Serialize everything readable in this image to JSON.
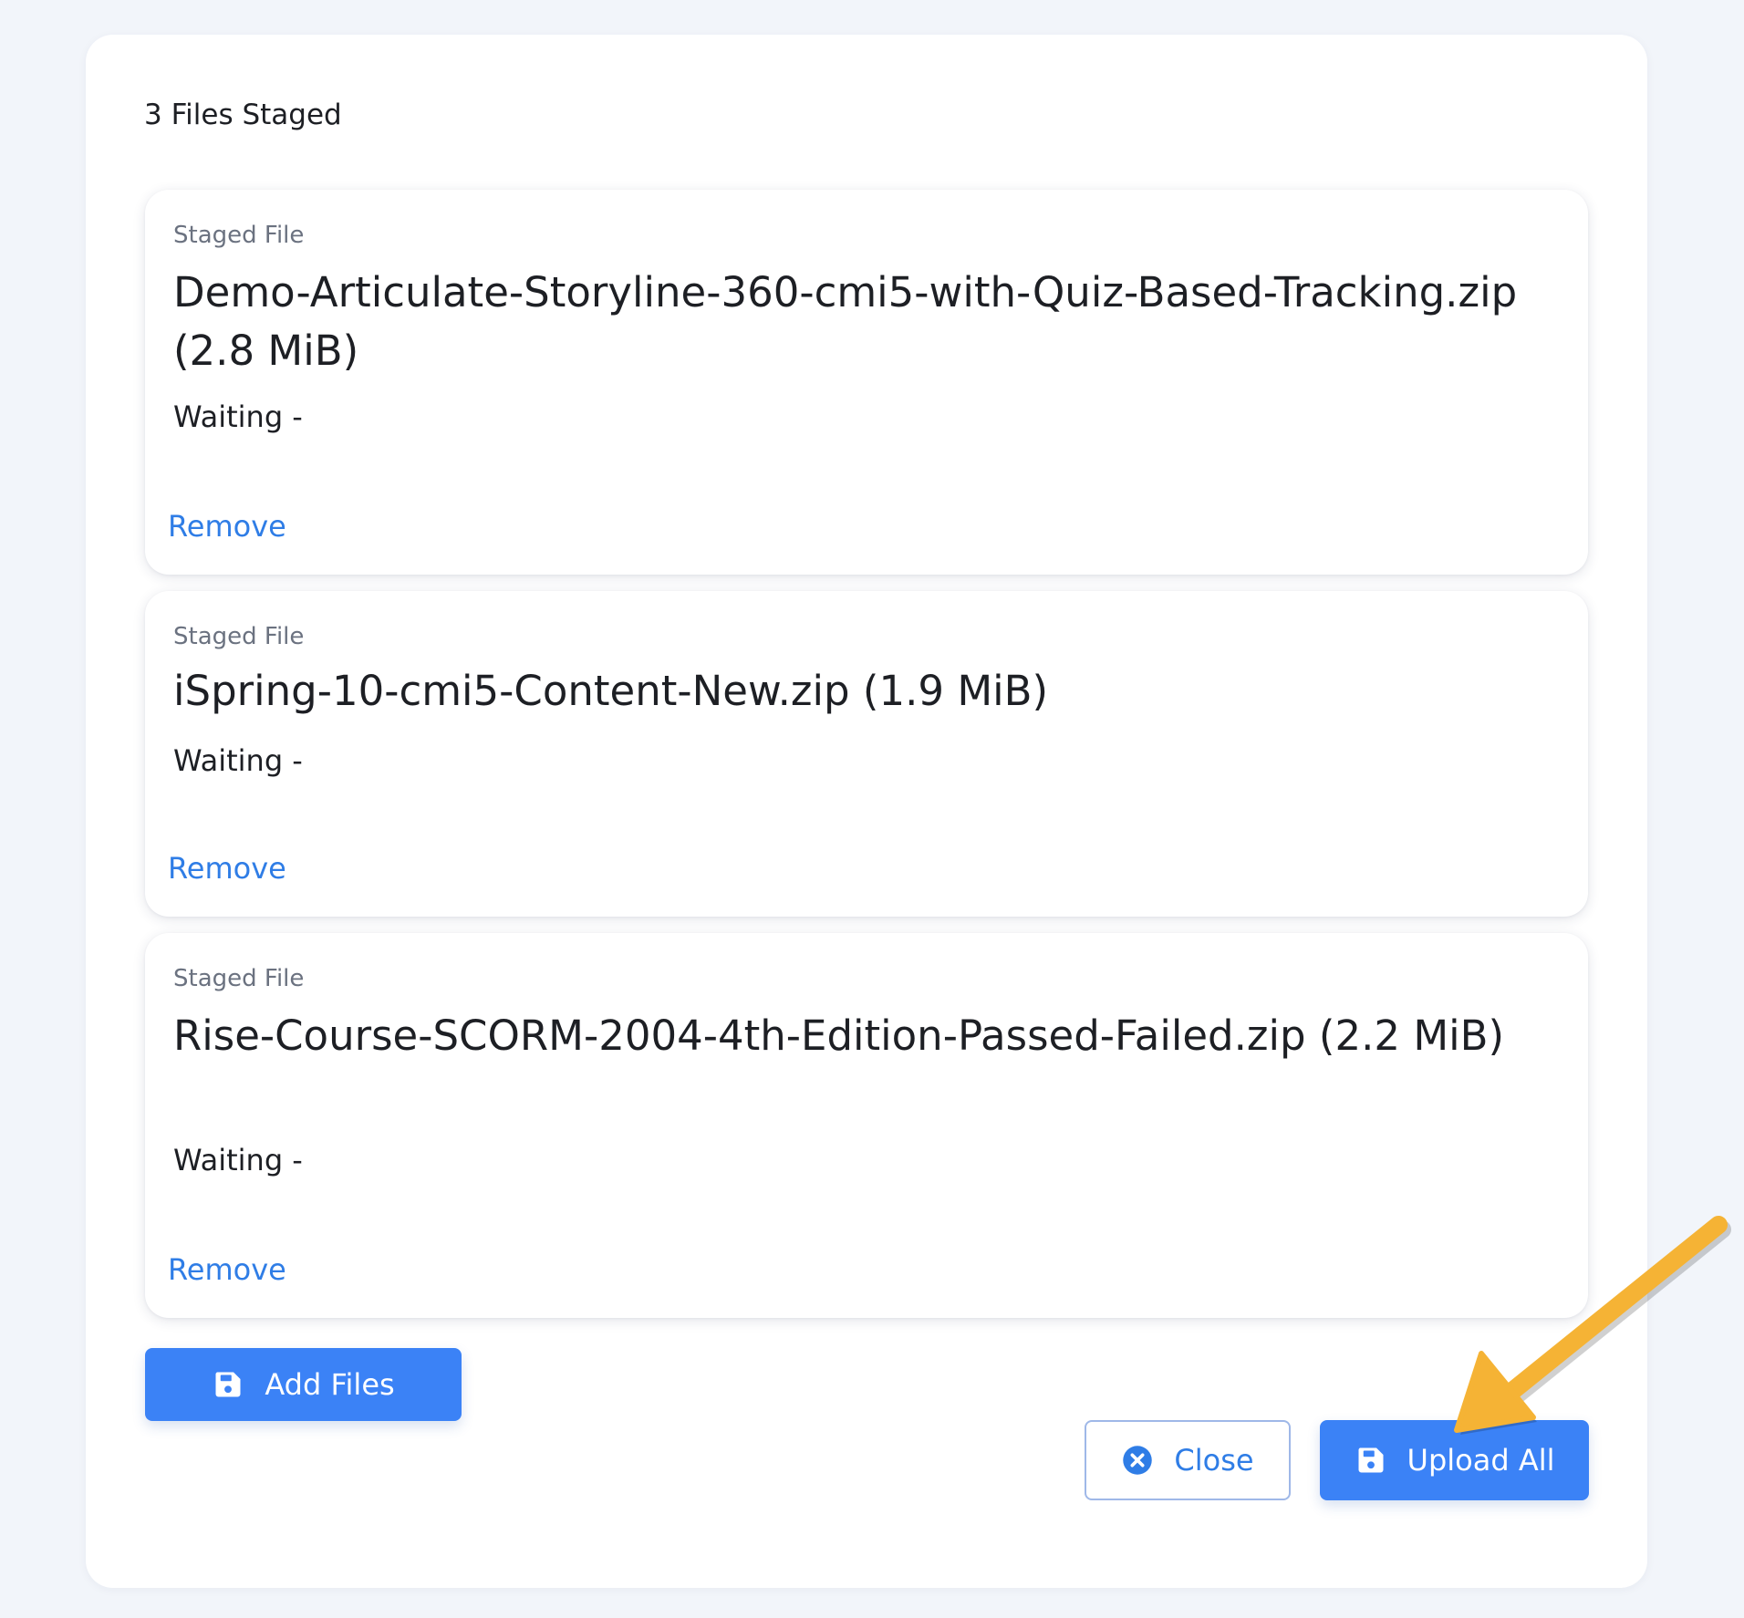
{
  "header": {
    "title": "3 Files Staged"
  },
  "staged_files": [
    {
      "kicker": "Staged File",
      "name": "Demo-Articulate-Storyline-360-cmi5-with-Quiz-Based-Tracking.zip (2.8 MiB)",
      "status": "Waiting -",
      "remove_label": "Remove"
    },
    {
      "kicker": "Staged File",
      "name": "iSpring-10-cmi5-Content-New.zip (1.9 MiB)",
      "status": "Waiting -",
      "remove_label": "Remove"
    },
    {
      "kicker": "Staged File",
      "name": "Rise-Course-SCORM-2004-4th-Edition-Passed-Failed.zip (2.2 MiB)",
      "status": "Waiting -",
      "remove_label": "Remove"
    }
  ],
  "actions": {
    "add_files_label": "Add Files",
    "add_files_icon": "floppy-disk-icon",
    "close_label": "Close",
    "close_icon": "circle-x-icon",
    "upload_all_label": "Upload All",
    "upload_all_icon": "floppy-disk-icon"
  },
  "annotation": {
    "arrow_color": "#f5b335",
    "arrow_icon": "pointer-arrow-icon"
  },
  "colors": {
    "accent": "#3b82f6",
    "link": "#2f7de6",
    "page_background": "#f2f5fa"
  }
}
